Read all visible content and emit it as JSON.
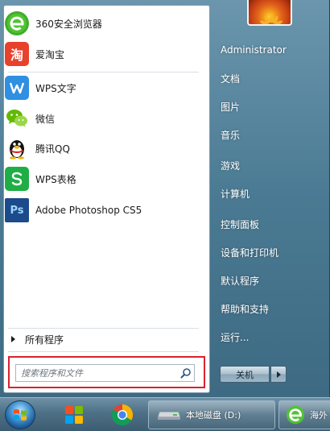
{
  "start_menu": {
    "pinned_programs": [
      {
        "label": "360安全浏览器",
        "icon": "360-browser-icon",
        "glyph": "e",
        "color": "#3fae2a"
      },
      {
        "label": "爱淘宝",
        "icon": "taobao-icon",
        "glyph": "淘",
        "color": "#e8412c"
      }
    ],
    "recent_programs": [
      {
        "label": "WPS文字",
        "icon": "wps-writer-icon",
        "glyph": "W",
        "color": "#2f8fe0"
      },
      {
        "label": "微信",
        "icon": "wechat-icon",
        "glyph": "",
        "color": "#62b900"
      },
      {
        "label": "腾讯QQ",
        "icon": "qq-penguin-icon",
        "glyph": "",
        "color": "#111111"
      },
      {
        "label": "WPS表格",
        "icon": "wps-spreadsheet-icon",
        "glyph": "S",
        "color": "#1fae45"
      },
      {
        "label": "Adobe Photoshop CS5",
        "icon": "photoshop-icon",
        "glyph": "Ps",
        "color": "#1b4b8a"
      }
    ],
    "all_programs_label": "所有程序",
    "search": {
      "placeholder": "搜索程序和文件",
      "value": ""
    },
    "right_pane": {
      "user_name": "Administrator",
      "items": [
        "文档",
        "图片",
        "音乐",
        "游戏",
        "计算机",
        "控制面板",
        "设备和打印机",
        "默认程序",
        "帮助和支持",
        "运行..."
      ]
    },
    "shutdown_label": "关机",
    "highlight_color": "#d9232e"
  },
  "taskbar": {
    "pinned": [
      {
        "icon": "windows-start-orb-icon"
      },
      {
        "icon": "windows-store-tiles-icon"
      },
      {
        "icon": "chrome-icon"
      }
    ],
    "windows": [
      {
        "label": "本地磁盘 (D:)",
        "icon": "drive-icon"
      },
      {
        "label": "海外",
        "icon": "360-browser-icon"
      }
    ]
  }
}
